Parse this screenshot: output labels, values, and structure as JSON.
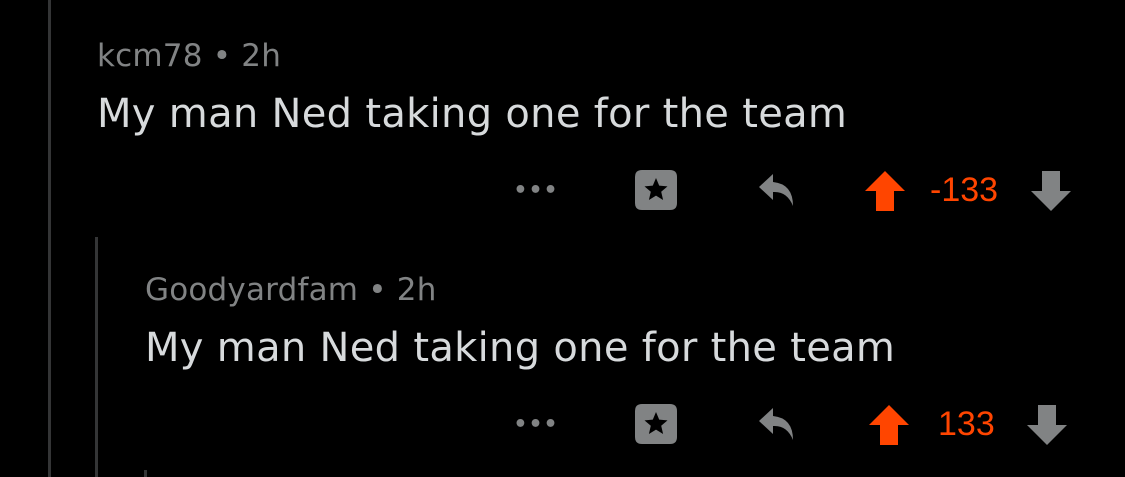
{
  "comments": [
    {
      "author": "kcm78",
      "separator": "•",
      "age": "2h",
      "body": "My man Ned taking one for the team",
      "more_label": "•••",
      "score": "-133",
      "upvoted": true,
      "colors": {
        "upvote": "#ff4500",
        "score": "#ff4500",
        "muted": "#818384"
      }
    },
    {
      "author": "Goodyardfam",
      "separator": "•",
      "age": "2h",
      "body": "My man Ned taking one for the team",
      "more_label": "•••",
      "score": "133",
      "upvoted": true,
      "colors": {
        "upvote": "#ff4500",
        "score": "#ff4500",
        "muted": "#818384"
      }
    }
  ],
  "icons": [
    "more-options-icon",
    "award-icon",
    "reply-icon",
    "upvote-icon",
    "downvote-icon"
  ]
}
